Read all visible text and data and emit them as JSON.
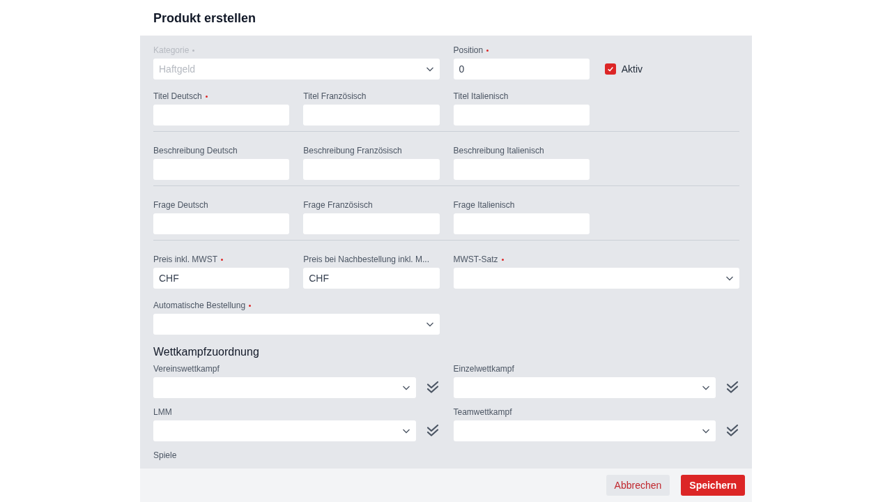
{
  "title": "Produkt erstellen",
  "groups": [
    {
      "kind": "form",
      "fields": [
        {
          "kind": "select",
          "label": "Kategorie",
          "required": true,
          "disabled": true,
          "wide": true,
          "value": "Haftgeld"
        },
        {
          "kind": "text",
          "label": "Position",
          "required": true,
          "disabled": false,
          "value": "0"
        },
        {
          "kind": "checkbox",
          "label": "Aktiv",
          "checked": true
        },
        {
          "kind": "text",
          "label": "Titel Deutsch",
          "required": true,
          "disabled": false
        },
        {
          "kind": "text",
          "label": "Titel Französisch"
        },
        {
          "kind": "text",
          "label": "Titel Italienisch"
        }
      ]
    },
    {
      "kind": "form",
      "fields": [
        {
          "kind": "text",
          "label": "Beschreibung Deutsch"
        },
        {
          "kind": "text",
          "label": "Beschreibung Französisch"
        },
        {
          "kind": "text",
          "label": "Beschreibung Italienisch"
        }
      ]
    },
    {
      "kind": "form",
      "fields": [
        {
          "kind": "text",
          "label": "Frage Deutsch"
        },
        {
          "kind": "text",
          "label": "Frage Französisch"
        },
        {
          "kind": "text",
          "label": "Frage Italienisch"
        }
      ]
    },
    {
      "kind": "form",
      "fields": [
        {
          "kind": "text",
          "label": "Preis inkl. MWST",
          "required": true,
          "disabled": false,
          "value": "CHF"
        },
        {
          "kind": "text",
          "label": "Preis bei Nachbestellung inkl. M...",
          "value": "CHF"
        },
        {
          "kind": "select",
          "label": "MWST-Satz",
          "required": true,
          "disabled": false,
          "wide": true
        },
        {
          "kind": "select",
          "label": "Automatische Bestellung",
          "required": true,
          "disabled": false,
          "wide": true
        }
      ]
    },
    {
      "kind": "heading",
      "title": "Wettkampfzuordnung"
    },
    {
      "kind": "assign",
      "fields": [
        {
          "kind": "select",
          "label": "Vereinswettkampf"
        },
        {
          "kind": "select",
          "label": "Einzelwettkampf"
        },
        {
          "kind": "select",
          "label": "LMM"
        },
        {
          "kind": "select",
          "label": "Teamwettkampf"
        },
        {
          "kind": "label",
          "label": "Spiele"
        }
      ]
    }
  ],
  "buttons": [
    {
      "kind": "secondary",
      "label": "Abbrechen"
    },
    {
      "kind": "primary",
      "label": "Speichern"
    }
  ]
}
